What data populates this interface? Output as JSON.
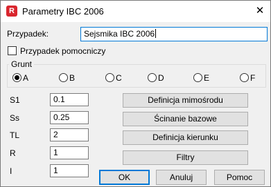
{
  "window": {
    "title": "Parametry IBC 2006",
    "icon_letter": "R",
    "close_glyph": "✕",
    "brand_color": "#d9262e"
  },
  "form": {
    "name_label": "Przypadek:",
    "name_value": "Sejsmika IBC 2006",
    "auxiliary_label": "Przypadek pomocniczy",
    "auxiliary_checked": false
  },
  "soil": {
    "group_label": "Grunt",
    "options": [
      "A",
      "B",
      "C",
      "D",
      "E",
      "F"
    ],
    "selected": "A"
  },
  "params": [
    {
      "label": "S1",
      "value": "0.1"
    },
    {
      "label": "Ss",
      "value": "0.25"
    },
    {
      "label": "TL",
      "value": "2"
    },
    {
      "label": "R",
      "value": "1"
    },
    {
      "label": "I",
      "value": "1"
    }
  ],
  "actions": {
    "eccentricity": "Definicja mimośrodu",
    "base_shear": "Ścinanie bazowe",
    "direction": "Definicja kierunku",
    "filters": "Filtry"
  },
  "footer": {
    "ok": "OK",
    "cancel": "Anuluj",
    "help": "Pomoc"
  }
}
